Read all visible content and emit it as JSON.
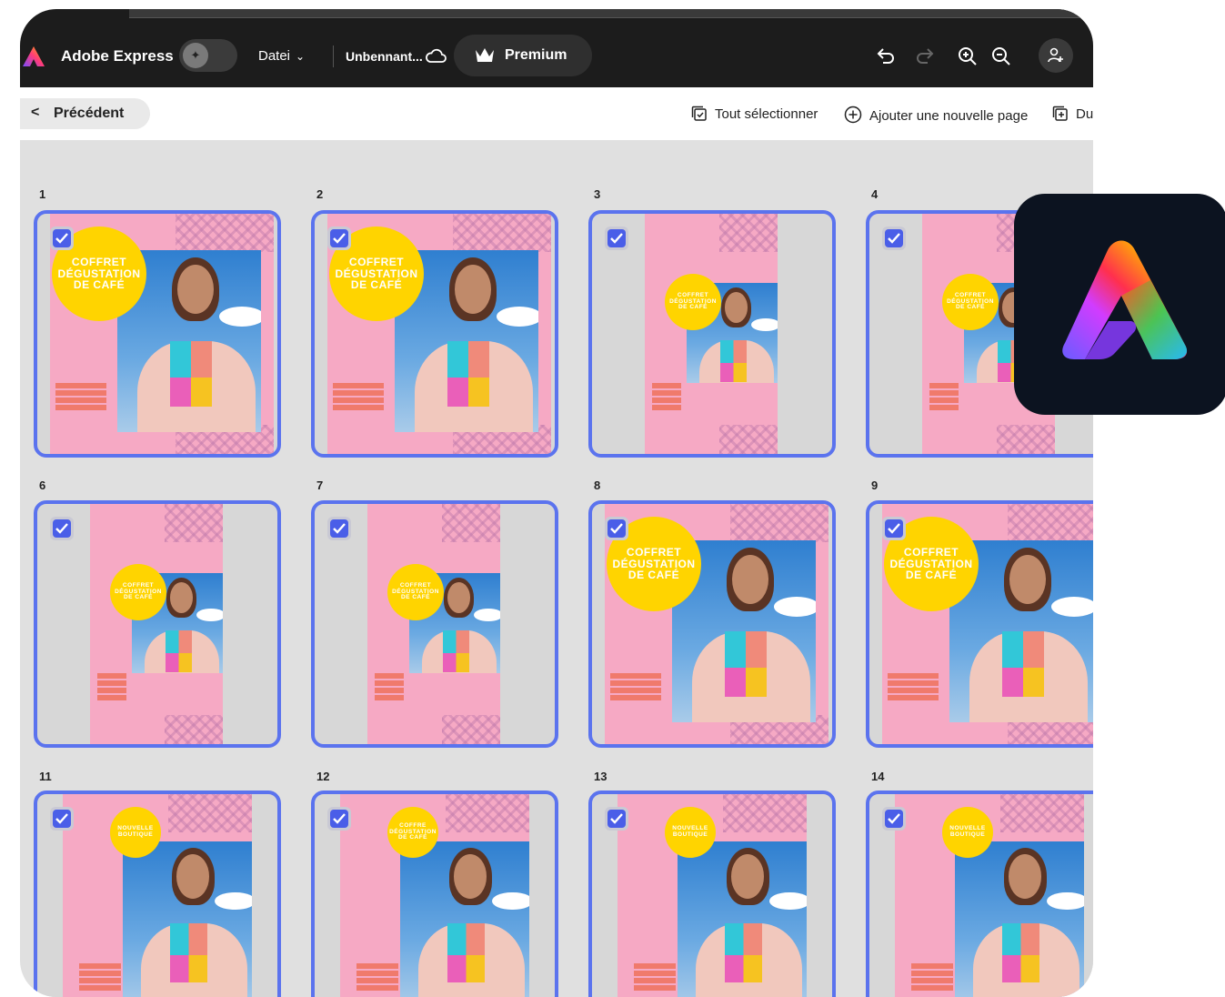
{
  "header": {
    "app_name": "Adobe Express",
    "file_menu": "Datei",
    "document_title": "Unbennant...",
    "premium_label": "Premium"
  },
  "subbar": {
    "back_label": "Précédent",
    "select_all_label": "Tout sélectionner",
    "add_page_label": "Ajouter une nouvelle page",
    "duplicate_label_partial": "Du"
  },
  "pages": [
    {
      "number": "1",
      "selected": true,
      "layout": "full",
      "circle_text": "COFFRET DÉGUSTATION DE CAFÉ"
    },
    {
      "number": "2",
      "selected": true,
      "layout": "full",
      "circle_text": "COFFRET DÉGUSTATION DE CAFÉ"
    },
    {
      "number": "3",
      "selected": true,
      "layout": "narrow",
      "circle_text": "COFFRET DÉGUSTATION DE CAFÉ"
    },
    {
      "number": "4",
      "selected": true,
      "layout": "narrow",
      "circle_text": "COFFRET DÉGUSTATION DE CAFÉ"
    },
    {
      "number": "6",
      "selected": true,
      "layout": "narrow",
      "circle_text": "COFFRET DÉGUSTATION DE CAFÉ"
    },
    {
      "number": "7",
      "selected": true,
      "layout": "narrow",
      "circle_text": "COFFRET DÉGUSTATION DE CAFÉ"
    },
    {
      "number": "8",
      "selected": true,
      "layout": "full",
      "circle_text": "COFFRET DÉGUSTATION DE CAFÉ"
    },
    {
      "number": "9",
      "selected": true,
      "layout": "full",
      "circle_text": "COFFRET DÉGUSTATION DE CAFÉ"
    },
    {
      "number": "11",
      "selected": true,
      "layout": "tall",
      "circle_text": "NOUVELLE BOUTIQUE"
    },
    {
      "number": "12",
      "selected": true,
      "layout": "tall",
      "circle_text": "COFFRE DÉGUSTATION DE CAFÉ"
    },
    {
      "number": "13",
      "selected": true,
      "layout": "tall",
      "circle_text": "NOUVELLE BOUTIQUE"
    },
    {
      "number": "14",
      "selected": true,
      "layout": "tall",
      "circle_text": "NOUVELLE BOUTIQUE"
    }
  ],
  "colors": {
    "topbar": "#1c1c1c",
    "selection_border": "#5b73ee",
    "checkbox": "#4a5ee8",
    "poster_pink": "#f6a9c4",
    "poster_yellow": "#ffd400",
    "canvas_bg": "#e0e0e0"
  },
  "icons": {
    "undo": "undo-icon",
    "redo": "redo-icon",
    "zoom_in": "zoom-in-icon",
    "zoom_out": "zoom-out-icon",
    "share": "add-user-icon",
    "cloud": "cloud-icon",
    "crown": "crown-icon"
  }
}
